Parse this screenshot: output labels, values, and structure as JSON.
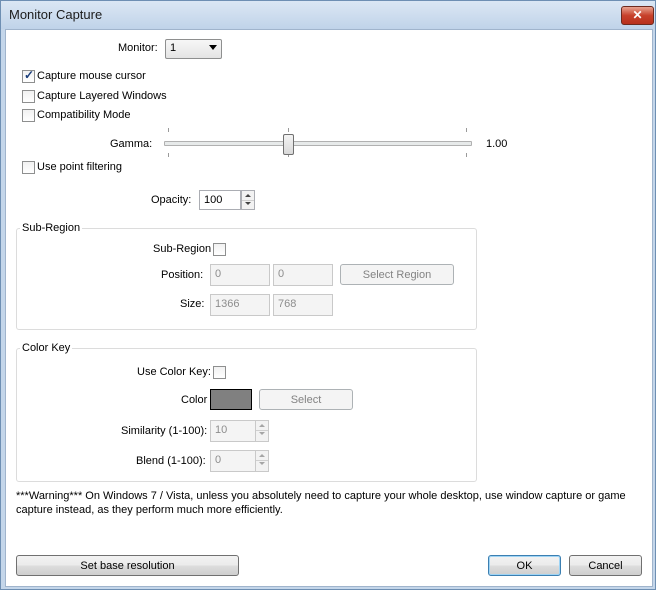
{
  "window": {
    "title": "Monitor Capture",
    "close_symbol": "✕"
  },
  "monitor": {
    "label": "Monitor:",
    "value": "1"
  },
  "options": {
    "capture_mouse": {
      "label": "Capture mouse cursor",
      "checked": true
    },
    "capture_layered": {
      "label": "Capture Layered Windows",
      "checked": false
    },
    "compatibility": {
      "label": "Compatibility Mode",
      "checked": false
    }
  },
  "gamma": {
    "label": "Gamma:",
    "value": "1.00",
    "slider_fraction": 0.405
  },
  "point_filtering": {
    "label": "Use point filtering",
    "checked": false
  },
  "opacity": {
    "label": "Opacity:",
    "value": "100"
  },
  "subregion": {
    "group_title": "Sub-Region",
    "enable_label": "Sub-Region",
    "enabled": false,
    "position_label": "Position:",
    "pos_x": "0",
    "pos_y": "0",
    "select_region_label": "Select Region",
    "size_label": "Size:",
    "width": "1366",
    "height": "768"
  },
  "colorkey": {
    "group_title": "Color Key",
    "use_label": "Use Color Key:",
    "enabled": false,
    "color_label": "Color",
    "color_value": "#808080",
    "select_label": "Select",
    "similarity_label": "Similarity (1-100):",
    "similarity_value": "10",
    "blend_label": "Blend (1-100):",
    "blend_value": "0"
  },
  "warning_text": "***Warning*** On Windows 7 / Vista, unless you absolutely need to capture your whole desktop, use window capture or game capture instead, as they perform much more efficiently.",
  "buttons": {
    "base_resolution": "Set base resolution",
    "ok": "OK",
    "cancel": "Cancel"
  }
}
